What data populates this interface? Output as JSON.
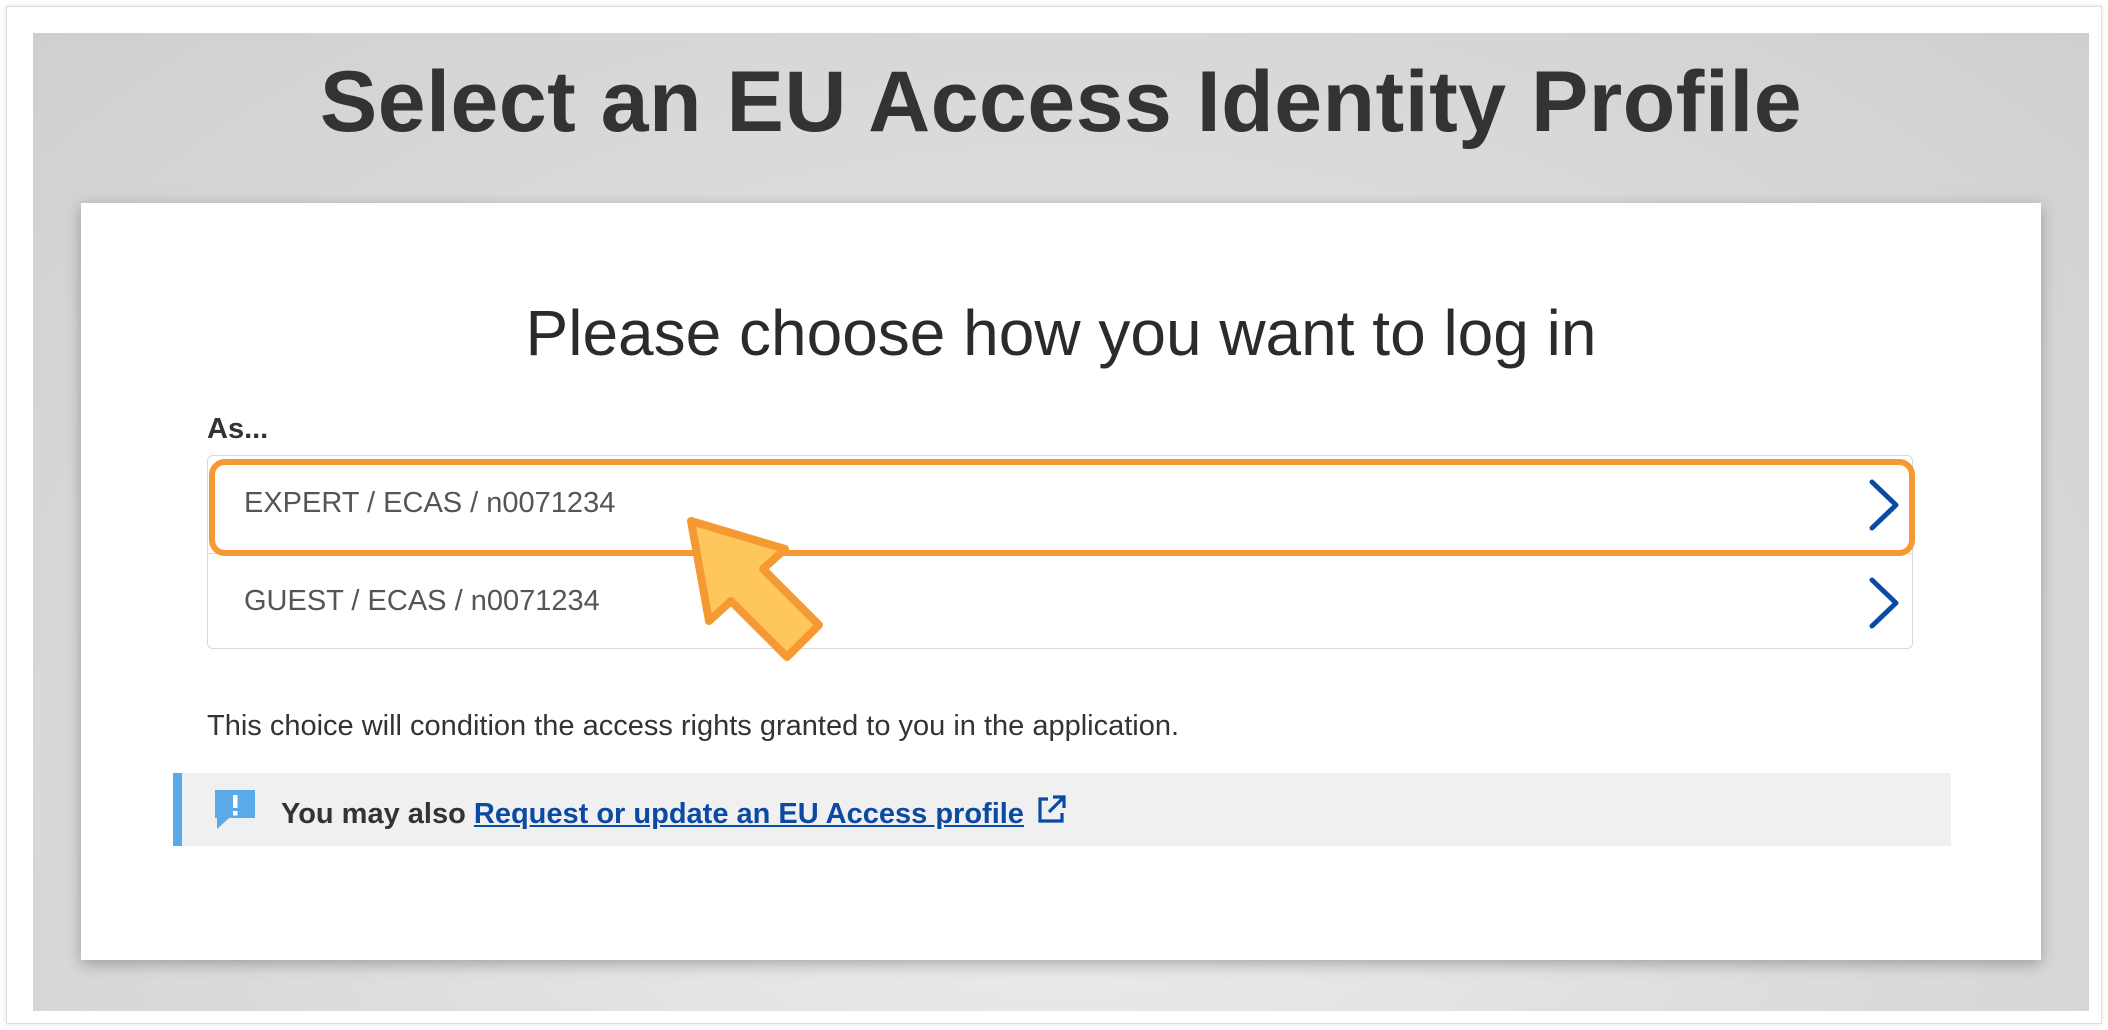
{
  "page": {
    "title": "Select an EU Access Identity Profile"
  },
  "card": {
    "heading": "Please choose how you want to log in",
    "as_label": "As...",
    "profiles": [
      {
        "label": "EXPERT / ECAS / n0071234",
        "selected": true
      },
      {
        "label": "GUEST / ECAS / n0071234",
        "selected": false
      }
    ],
    "note": "This choice will condition the access rights granted to you in the application.",
    "info": {
      "prefix": "You may also ",
      "link_label": "Request or update an EU Access profile"
    }
  },
  "icons": {
    "row_chevron": "chevron-right-icon",
    "info": "speech-bubble-exclamation-icon",
    "external_link": "external-link-icon",
    "pointer": "arrow-pointer-icon"
  },
  "colors": {
    "highlight": "#f59a32",
    "pointer_fill": "#ffc65c",
    "chevron": "#0b4aa2",
    "link": "#0b4aa2",
    "info_accent": "#5aa9e8"
  }
}
